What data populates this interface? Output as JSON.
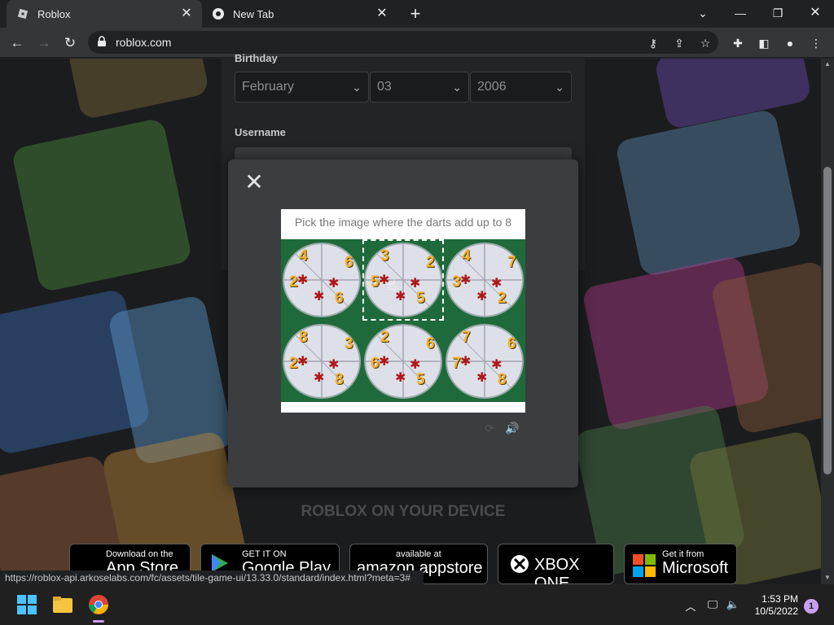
{
  "browser": {
    "tabs": [
      {
        "title": "Roblox"
      },
      {
        "title": "New Tab"
      }
    ],
    "url": "roblox.com",
    "status_url": "https://roblox-api.arkoselabs.com/fc/assets/tile-game-ui/13.33.0/standard/index.html?meta=3#"
  },
  "form": {
    "birthday_label": "Birthday",
    "month": "February",
    "day": "03",
    "year": "2006",
    "username_label": "Username"
  },
  "captcha": {
    "prompt": "Pick the image where the darts add up to 8",
    "tiles": [
      {
        "numbers": [
          "4",
          "6",
          "2",
          "6"
        ]
      },
      {
        "numbers": [
          "3",
          "2",
          "5",
          "5"
        ]
      },
      {
        "numbers": [
          "4",
          "7",
          "3",
          "2"
        ]
      },
      {
        "numbers": [
          "8",
          "3",
          "2",
          "8"
        ]
      },
      {
        "numbers": [
          "2",
          "6",
          "6",
          "5"
        ]
      },
      {
        "numbers": [
          "7",
          "6",
          "7",
          "8"
        ]
      }
    ],
    "selected_tile": 2
  },
  "devices": {
    "title": "ROBLOX ON YOUR DEVICE",
    "stores": [
      {
        "small": "Download on the",
        "big": "App Store"
      },
      {
        "small": "GET IT ON",
        "big": "Google Play"
      },
      {
        "small": "available at",
        "big": "amazon appstore"
      },
      {
        "small": "",
        "big": "XBOX ONE"
      },
      {
        "small": "Get it from",
        "big": "Microsoft"
      }
    ]
  },
  "taskbar": {
    "time": "1:53 PM",
    "date": "10/5/2022",
    "notifications": "1"
  }
}
